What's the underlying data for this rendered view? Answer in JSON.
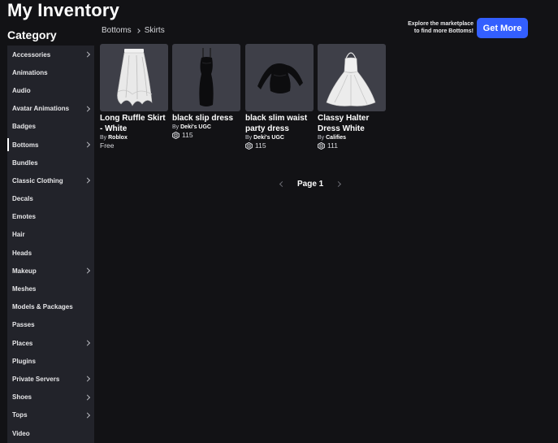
{
  "header": {
    "title": "My Inventory"
  },
  "sidebar": {
    "heading": "Category",
    "items": [
      {
        "label": "Accessories",
        "chevron": true
      },
      {
        "label": "Animations",
        "chevron": false
      },
      {
        "label": "Audio",
        "chevron": false
      },
      {
        "label": "Avatar Animations",
        "chevron": true
      },
      {
        "label": "Badges",
        "chevron": false
      },
      {
        "label": "Bottoms",
        "chevron": true,
        "selected": true
      },
      {
        "label": "Bundles",
        "chevron": false
      },
      {
        "label": "Classic Clothing",
        "chevron": true
      },
      {
        "label": "Decals",
        "chevron": false
      },
      {
        "label": "Emotes",
        "chevron": false
      },
      {
        "label": "Hair",
        "chevron": false
      },
      {
        "label": "Heads",
        "chevron": false
      },
      {
        "label": "Makeup",
        "chevron": true
      },
      {
        "label": "Meshes",
        "chevron": false
      },
      {
        "label": "Models & Packages",
        "chevron": false
      },
      {
        "label": "Passes",
        "chevron": false
      },
      {
        "label": "Places",
        "chevron": true
      },
      {
        "label": "Plugins",
        "chevron": false
      },
      {
        "label": "Private Servers",
        "chevron": true
      },
      {
        "label": "Shoes",
        "chevron": true
      },
      {
        "label": "Tops",
        "chevron": true
      },
      {
        "label": "Video",
        "chevron": false
      }
    ]
  },
  "breadcrumb": {
    "parent": "Bottoms",
    "current": "Skirts"
  },
  "promo": {
    "line1": "Explore the marketplace",
    "line2": "to find more Bottoms!",
    "button": "Get More",
    "accent": "#335fff"
  },
  "items": [
    {
      "name": "Long Ruffle Skirt - White",
      "by": "By",
      "creator": "Roblox",
      "price": "Free",
      "robux": false,
      "icon": "white-skirt-image"
    },
    {
      "name": "black slip dress",
      "by": "By",
      "creator": "Deki's UGC",
      "price": "115",
      "robux": true,
      "icon": "black-dress-image"
    },
    {
      "name": "black slim waist party dress",
      "by": "By",
      "creator": "Deki's UGC",
      "price": "115",
      "robux": true,
      "icon": "black-party-dress-image"
    },
    {
      "name": "Classy Halter Dress White",
      "by": "By",
      "creator": "Califies",
      "price": "111",
      "robux": true,
      "icon": "white-halter-dress-image"
    }
  ],
  "pagination": {
    "label": "Page 1"
  }
}
